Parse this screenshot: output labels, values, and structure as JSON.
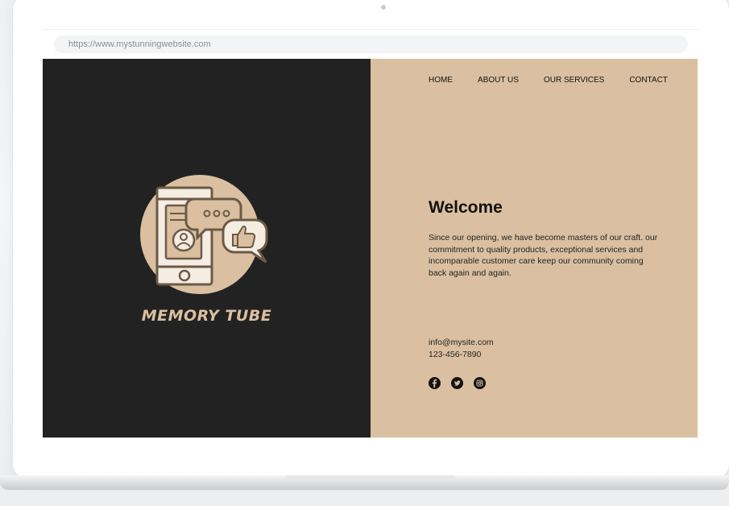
{
  "browser": {
    "url": "https://www.mystunningwebsite.com"
  },
  "brand": {
    "name": "MEMORY TUBE",
    "accent_color": "#dac0a0",
    "dark_color": "#222222"
  },
  "nav": {
    "items": [
      {
        "label": "HOME"
      },
      {
        "label": "ABOUT US"
      },
      {
        "label": "OUR SERVICES"
      },
      {
        "label": "CONTACT"
      }
    ]
  },
  "hero": {
    "title": "Welcome",
    "body": "Since our opening, we have become masters of our craft. our commitment to quality products, exceptional services and incomparable customer care keep our community coming back again and again."
  },
  "contact": {
    "email": "info@mysite.com",
    "phone": "123-456-7890"
  },
  "socials": [
    {
      "icon": "facebook-icon"
    },
    {
      "icon": "twitter-icon"
    },
    {
      "icon": "instagram-icon"
    }
  ]
}
